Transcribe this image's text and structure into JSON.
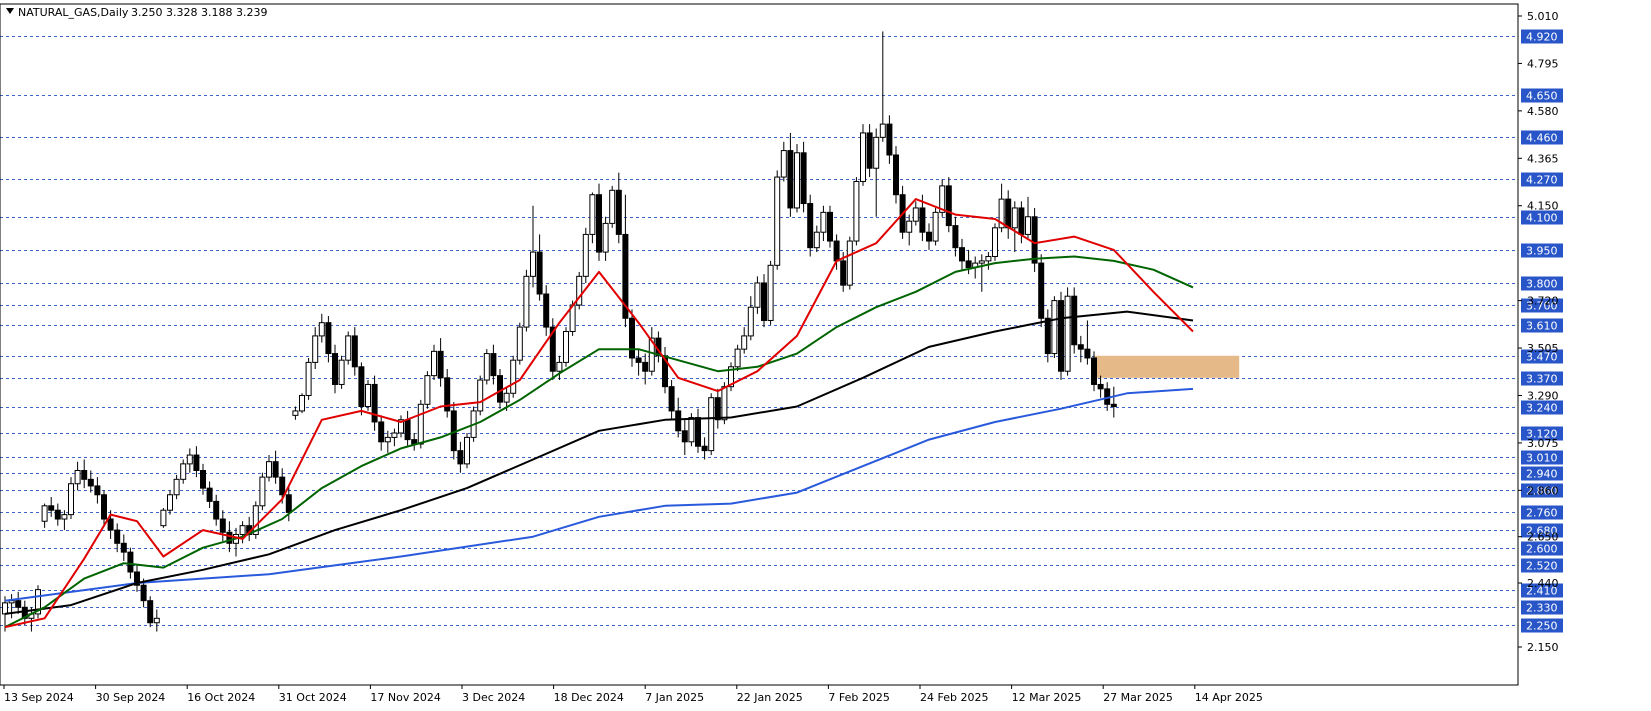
{
  "header": {
    "symbol_caption": "NATURAL_GAS,Daily",
    "ohlc": "3.250 3.328 3.188 3.239"
  },
  "colors": {
    "background": "#ffffff",
    "grid_line": "#3c64c8",
    "level_label_bg": "#2855c8",
    "zone_fill": "#e6b988",
    "candle": "#000000",
    "ma_fast": "#e00000",
    "ma_mid": "#006400",
    "ma_slow": "#000000",
    "ma_long": "#2a5adc"
  },
  "chart_data": {
    "type": "candlestick",
    "ylim": [
      2.15,
      5.01
    ],
    "y_ticks": [
      "5.010",
      "4.795",
      "4.580",
      "4.365",
      "4.150",
      "3.720",
      "3.505",
      "3.290",
      "3.075",
      "2.860",
      "2.650",
      "2.440",
      "2.150"
    ],
    "horizontal_levels": [
      "4.920",
      "4.650",
      "4.460",
      "4.270",
      "4.100",
      "3.950",
      "3.800",
      "3.700",
      "3.610",
      "3.470",
      "3.370",
      "3.240",
      "3.120",
      "3.010",
      "2.940",
      "2.860",
      "2.760",
      "2.680",
      "2.600",
      "2.520",
      "2.410",
      "2.330",
      "2.250"
    ],
    "x_labels": [
      "13 Sep 2024",
      "30 Sep 2024",
      "16 Oct 2024",
      "31 Oct 2024",
      "17 Nov 2024",
      "3 Dec 2024",
      "18 Dec 2024",
      "7 Jan 2025",
      "22 Jan 2025",
      "7 Feb 2025",
      "24 Feb 2025",
      "12 Mar 2025",
      "27 Mar 2025",
      "14 Apr 2025"
    ],
    "zone": {
      "low": 3.37,
      "high": 3.47,
      "start_bar": 165,
      "end_bar": 187
    },
    "candles": [
      [
        2.3,
        2.38,
        2.22,
        2.35
      ],
      [
        2.35,
        2.39,
        2.28,
        2.36
      ],
      [
        2.36,
        2.4,
        2.3,
        2.33
      ],
      [
        2.33,
        2.36,
        2.25,
        2.28
      ],
      [
        2.28,
        2.33,
        2.22,
        2.3
      ],
      [
        2.3,
        2.43,
        2.28,
        2.41
      ],
      [
        2.72,
        2.8,
        2.69,
        2.79
      ],
      [
        2.79,
        2.83,
        2.74,
        2.77
      ],
      [
        2.77,
        2.8,
        2.7,
        2.73
      ],
      [
        2.73,
        2.77,
        2.68,
        2.75
      ],
      [
        2.75,
        2.92,
        2.73,
        2.89
      ],
      [
        2.89,
        2.99,
        2.86,
        2.95
      ],
      [
        2.95,
        3.0,
        2.87,
        2.91
      ],
      [
        2.91,
        2.95,
        2.85,
        2.88
      ],
      [
        2.88,
        2.92,
        2.8,
        2.84
      ],
      [
        2.84,
        2.86,
        2.7,
        2.73
      ],
      [
        2.73,
        2.77,
        2.64,
        2.68
      ],
      [
        2.68,
        2.71,
        2.58,
        2.62
      ],
      [
        2.62,
        2.66,
        2.54,
        2.58
      ],
      [
        2.58,
        2.6,
        2.46,
        2.49
      ],
      [
        2.49,
        2.52,
        2.4,
        2.43
      ],
      [
        2.43,
        2.46,
        2.33,
        2.36
      ],
      [
        2.36,
        2.38,
        2.24,
        2.26
      ],
      [
        2.26,
        2.32,
        2.22,
        2.28
      ],
      [
        2.7,
        2.78,
        2.69,
        2.77
      ],
      [
        2.77,
        2.86,
        2.75,
        2.84
      ],
      [
        2.84,
        2.93,
        2.82,
        2.91
      ],
      [
        2.91,
        3.0,
        2.89,
        2.98
      ],
      [
        2.98,
        3.05,
        2.94,
        3.02
      ],
      [
        3.02,
        3.06,
        2.92,
        2.95
      ],
      [
        2.95,
        2.98,
        2.84,
        2.87
      ],
      [
        2.87,
        2.9,
        2.78,
        2.81
      ],
      [
        2.81,
        2.84,
        2.7,
        2.73
      ],
      [
        2.73,
        2.77,
        2.63,
        2.67
      ],
      [
        2.67,
        2.72,
        2.58,
        2.62
      ],
      [
        2.62,
        2.69,
        2.56,
        2.66
      ],
      [
        2.66,
        2.72,
        2.62,
        2.7
      ],
      [
        2.7,
        2.74,
        2.63,
        2.66
      ],
      [
        2.66,
        2.81,
        2.64,
        2.79
      ],
      [
        2.79,
        2.94,
        2.77,
        2.92
      ],
      [
        2.92,
        3.02,
        2.9,
        2.99
      ],
      [
        2.99,
        3.04,
        2.89,
        2.92
      ],
      [
        2.92,
        2.96,
        2.8,
        2.84
      ],
      [
        2.84,
        2.88,
        2.72,
        2.76
      ],
      [
        3.2,
        3.24,
        3.18,
        3.22
      ],
      [
        3.22,
        3.3,
        3.21,
        3.29
      ],
      [
        3.29,
        3.46,
        3.27,
        3.44
      ],
      [
        3.44,
        3.6,
        3.41,
        3.56
      ],
      [
        3.56,
        3.66,
        3.53,
        3.62
      ],
      [
        3.62,
        3.65,
        3.44,
        3.48
      ],
      [
        3.48,
        3.52,
        3.3,
        3.34
      ],
      [
        3.34,
        3.47,
        3.32,
        3.45
      ],
      [
        3.45,
        3.58,
        3.43,
        3.56
      ],
      [
        3.56,
        3.6,
        3.38,
        3.42
      ],
      [
        3.42,
        3.44,
        3.2,
        3.24
      ],
      [
        3.24,
        3.36,
        3.22,
        3.34
      ],
      [
        3.34,
        3.38,
        3.13,
        3.17
      ],
      [
        3.17,
        3.2,
        3.04,
        3.08
      ],
      [
        3.08,
        3.13,
        3.03,
        3.1
      ],
      [
        3.1,
        3.14,
        3.06,
        3.12
      ],
      [
        3.12,
        3.2,
        3.1,
        3.18
      ],
      [
        3.18,
        3.22,
        3.06,
        3.09
      ],
      [
        3.09,
        3.12,
        3.04,
        3.07
      ],
      [
        3.07,
        3.27,
        3.05,
        3.25
      ],
      [
        3.25,
        3.4,
        3.23,
        3.38
      ],
      [
        3.38,
        3.52,
        3.36,
        3.49
      ],
      [
        3.49,
        3.55,
        3.33,
        3.37
      ],
      [
        3.37,
        3.41,
        3.19,
        3.22
      ],
      [
        3.22,
        3.26,
        3.0,
        3.04
      ],
      [
        3.04,
        3.08,
        2.94,
        2.98
      ],
      [
        2.98,
        3.12,
        2.96,
        3.1
      ],
      [
        3.1,
        3.24,
        3.08,
        3.22
      ],
      [
        3.22,
        3.38,
        3.2,
        3.36
      ],
      [
        3.36,
        3.5,
        3.34,
        3.48
      ],
      [
        3.48,
        3.52,
        3.34,
        3.38
      ],
      [
        3.38,
        3.41,
        3.23,
        3.26
      ],
      [
        3.26,
        3.33,
        3.22,
        3.3
      ],
      [
        3.3,
        3.47,
        3.28,
        3.45
      ],
      [
        3.45,
        3.62,
        3.43,
        3.6
      ],
      [
        3.6,
        3.86,
        3.58,
        3.83
      ],
      [
        3.83,
        4.15,
        3.78,
        3.94
      ],
      [
        3.94,
        4.02,
        3.72,
        3.75
      ],
      [
        3.75,
        3.79,
        3.56,
        3.6
      ],
      [
        3.6,
        3.64,
        3.36,
        3.4
      ],
      [
        3.4,
        3.47,
        3.36,
        3.44
      ],
      [
        3.44,
        3.6,
        3.42,
        3.58
      ],
      [
        3.58,
        3.72,
        3.56,
        3.7
      ],
      [
        3.7,
        3.85,
        3.68,
        3.83
      ],
      [
        3.83,
        4.05,
        3.8,
        4.02
      ],
      [
        4.02,
        4.21,
        3.98,
        4.2
      ],
      [
        4.2,
        4.25,
        3.9,
        3.94
      ],
      [
        3.94,
        4.1,
        3.9,
        4.07
      ],
      [
        4.07,
        4.24,
        4.05,
        4.22
      ],
      [
        4.22,
        4.3,
        3.98,
        4.02
      ],
      [
        4.02,
        4.2,
        3.6,
        3.64
      ],
      [
        3.64,
        3.68,
        3.42,
        3.46
      ],
      [
        3.46,
        3.5,
        3.38,
        3.44
      ],
      [
        3.44,
        3.48,
        3.34,
        3.4
      ],
      [
        3.4,
        3.6,
        3.38,
        3.55
      ],
      [
        3.55,
        3.58,
        3.44,
        3.47
      ],
      [
        3.47,
        3.51,
        3.3,
        3.33
      ],
      [
        3.33,
        3.36,
        3.18,
        3.22
      ],
      [
        3.22,
        3.28,
        3.1,
        3.13
      ],
      [
        3.13,
        3.18,
        3.02,
        3.08
      ],
      [
        3.08,
        3.21,
        3.06,
        3.19
      ],
      [
        3.19,
        3.23,
        3.03,
        3.06
      ],
      [
        3.06,
        3.1,
        3.0,
        3.04
      ],
      [
        3.04,
        3.3,
        3.02,
        3.28
      ],
      [
        3.28,
        3.32,
        3.14,
        3.18
      ],
      [
        3.18,
        3.35,
        3.16,
        3.33
      ],
      [
        3.33,
        3.44,
        3.31,
        3.42
      ],
      [
        3.42,
        3.52,
        3.4,
        3.5
      ],
      [
        3.5,
        3.6,
        3.48,
        3.56
      ],
      [
        3.56,
        3.74,
        3.54,
        3.69
      ],
      [
        3.69,
        3.83,
        3.66,
        3.8
      ],
      [
        3.8,
        3.84,
        3.6,
        3.63
      ],
      [
        3.63,
        3.9,
        3.61,
        3.88
      ],
      [
        3.88,
        4.31,
        3.86,
        4.28
      ],
      [
        4.28,
        4.44,
        4.26,
        4.4
      ],
      [
        4.4,
        4.48,
        4.1,
        4.14
      ],
      [
        4.14,
        4.43,
        4.12,
        4.39
      ],
      [
        4.39,
        4.44,
        4.12,
        4.16
      ],
      [
        4.16,
        4.2,
        3.92,
        3.96
      ],
      [
        3.96,
        4.06,
        3.94,
        4.03
      ],
      [
        4.03,
        4.15,
        3.99,
        4.12
      ],
      [
        4.12,
        4.15,
        3.96,
        3.99
      ],
      [
        3.99,
        4.02,
        3.86,
        3.9
      ],
      [
        3.9,
        3.94,
        3.76,
        3.79
      ],
      [
        3.79,
        4.01,
        3.77,
        3.99
      ],
      [
        3.99,
        4.28,
        3.97,
        4.26
      ],
      [
        4.26,
        4.52,
        4.24,
        4.48
      ],
      [
        4.48,
        4.52,
        4.28,
        4.32
      ],
      [
        4.32,
        4.5,
        4.1,
        4.46
      ],
      [
        4.46,
        4.94,
        4.44,
        4.52
      ],
      [
        4.52,
        4.56,
        4.34,
        4.38
      ],
      [
        4.38,
        4.42,
        4.16,
        4.2
      ],
      [
        4.2,
        4.24,
        4.0,
        4.03
      ],
      [
        4.03,
        4.11,
        3.97,
        4.08
      ],
      [
        4.08,
        4.17,
        4.06,
        4.14
      ],
      [
        4.14,
        4.2,
        3.99,
        4.03
      ],
      [
        4.03,
        4.07,
        3.95,
        3.99
      ],
      [
        3.99,
        4.14,
        3.97,
        4.12
      ],
      [
        4.12,
        4.27,
        4.1,
        4.24
      ],
      [
        4.24,
        4.28,
        4.03,
        4.06
      ],
      [
        4.06,
        4.1,
        3.92,
        3.96
      ],
      [
        3.96,
        4.0,
        3.86,
        3.9
      ],
      [
        3.9,
        3.95,
        3.84,
        3.87
      ],
      [
        3.87,
        3.92,
        3.82,
        3.89
      ],
      [
        3.89,
        3.93,
        3.76,
        3.9
      ],
      [
        3.9,
        3.94,
        3.86,
        3.92
      ],
      [
        3.92,
        4.07,
        3.9,
        4.05
      ],
      [
        4.05,
        4.25,
        4.03,
        4.18
      ],
      [
        4.18,
        4.22,
        4.0,
        4.05
      ],
      [
        4.05,
        4.17,
        3.94,
        4.14
      ],
      [
        4.14,
        4.17,
        3.98,
        4.02
      ],
      [
        4.02,
        4.19,
        4.0,
        4.1
      ],
      [
        4.1,
        4.14,
        3.85,
        3.89
      ],
      [
        3.89,
        3.93,
        3.6,
        3.64
      ],
      [
        3.64,
        3.68,
        3.44,
        3.48
      ],
      [
        3.48,
        3.74,
        3.46,
        3.72
      ],
      [
        3.72,
        3.76,
        3.36,
        3.4
      ],
      [
        3.4,
        3.78,
        3.38,
        3.74
      ],
      [
        3.74,
        3.78,
        3.48,
        3.52
      ],
      [
        3.52,
        3.56,
        3.44,
        3.5
      ],
      [
        3.5,
        3.63,
        3.43,
        3.46
      ],
      [
        3.46,
        3.49,
        3.31,
        3.34
      ],
      [
        3.34,
        3.38,
        3.28,
        3.32
      ],
      [
        3.32,
        3.35,
        3.22,
        3.25
      ],
      [
        3.25,
        3.33,
        3.19,
        3.24
      ]
    ],
    "ma_fast": [
      [
        0,
        2.24
      ],
      [
        6,
        2.28
      ],
      [
        12,
        2.55
      ],
      [
        16,
        2.75
      ],
      [
        20,
        2.72
      ],
      [
        24,
        2.56
      ],
      [
        30,
        2.68
      ],
      [
        36,
        2.64
      ],
      [
        42,
        2.82
      ],
      [
        48,
        3.18
      ],
      [
        54,
        3.22
      ],
      [
        60,
        3.17
      ],
      [
        66,
        3.24
      ],
      [
        72,
        3.26
      ],
      [
        78,
        3.36
      ],
      [
        84,
        3.62
      ],
      [
        90,
        3.85
      ],
      [
        96,
        3.62
      ],
      [
        102,
        3.37
      ],
      [
        108,
        3.31
      ],
      [
        114,
        3.4
      ],
      [
        120,
        3.56
      ],
      [
        126,
        3.9
      ],
      [
        132,
        3.98
      ],
      [
        138,
        4.18
      ],
      [
        144,
        4.11
      ],
      [
        150,
        4.09
      ],
      [
        156,
        3.98
      ],
      [
        162,
        4.01
      ],
      [
        168,
        3.95
      ],
      [
        174,
        3.76
      ],
      [
        180,
        3.58
      ]
    ],
    "ma_mid": [
      [
        0,
        2.24
      ],
      [
        6,
        2.33
      ],
      [
        12,
        2.46
      ],
      [
        18,
        2.53
      ],
      [
        24,
        2.51
      ],
      [
        30,
        2.6
      ],
      [
        36,
        2.65
      ],
      [
        42,
        2.73
      ],
      [
        48,
        2.87
      ],
      [
        54,
        2.97
      ],
      [
        60,
        3.05
      ],
      [
        66,
        3.1
      ],
      [
        72,
        3.17
      ],
      [
        78,
        3.27
      ],
      [
        84,
        3.39
      ],
      [
        90,
        3.5
      ],
      [
        96,
        3.5
      ],
      [
        102,
        3.45
      ],
      [
        108,
        3.4
      ],
      [
        114,
        3.42
      ],
      [
        120,
        3.48
      ],
      [
        126,
        3.6
      ],
      [
        132,
        3.69
      ],
      [
        138,
        3.76
      ],
      [
        144,
        3.85
      ],
      [
        150,
        3.89
      ],
      [
        156,
        3.91
      ],
      [
        162,
        3.92
      ],
      [
        168,
        3.9
      ],
      [
        174,
        3.86
      ],
      [
        180,
        3.78
      ]
    ],
    "ma_slow": [
      [
        0,
        2.3
      ],
      [
        10,
        2.34
      ],
      [
        20,
        2.44
      ],
      [
        30,
        2.5
      ],
      [
        40,
        2.57
      ],
      [
        50,
        2.68
      ],
      [
        60,
        2.77
      ],
      [
        70,
        2.87
      ],
      [
        80,
        3.0
      ],
      [
        90,
        3.13
      ],
      [
        100,
        3.18
      ],
      [
        110,
        3.19
      ],
      [
        120,
        3.24
      ],
      [
        130,
        3.37
      ],
      [
        140,
        3.51
      ],
      [
        150,
        3.58
      ],
      [
        160,
        3.64
      ],
      [
        170,
        3.67
      ],
      [
        180,
        3.63
      ]
    ],
    "ma_long": [
      [
        0,
        2.36
      ],
      [
        20,
        2.44
      ],
      [
        40,
        2.48
      ],
      [
        60,
        2.56
      ],
      [
        80,
        2.65
      ],
      [
        90,
        2.74
      ],
      [
        100,
        2.79
      ],
      [
        110,
        2.8
      ],
      [
        120,
        2.85
      ],
      [
        130,
        2.97
      ],
      [
        140,
        3.09
      ],
      [
        150,
        3.17
      ],
      [
        160,
        3.23
      ],
      [
        170,
        3.3
      ],
      [
        180,
        3.32
      ]
    ]
  }
}
